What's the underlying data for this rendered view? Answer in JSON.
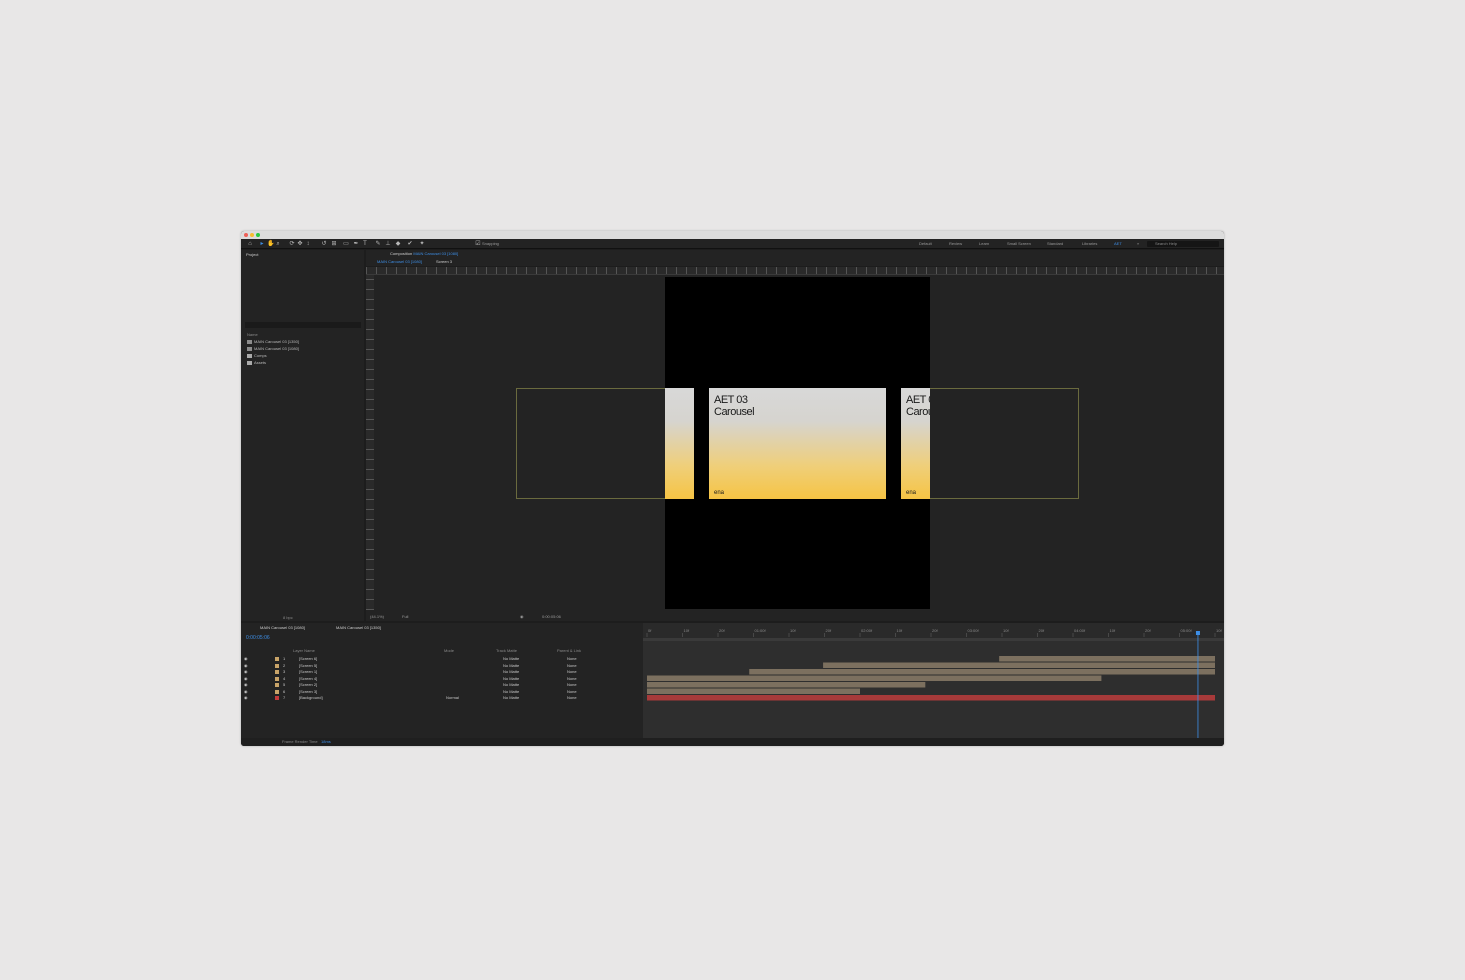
{
  "app": {
    "workspaces": [
      "Default",
      "Review",
      "Learn",
      "Small Screen",
      "Standard",
      "Libraries",
      "AET"
    ],
    "search_placeholder": "Search Help",
    "snapping_label": "Snapping"
  },
  "project": {
    "tab_label": "Project",
    "column_name": "Name",
    "items": [
      {
        "label": "MAIN Carousel 03 [1350]",
        "type": "comp"
      },
      {
        "label": "MAIN Carousel 03 [1080]",
        "type": "comp"
      },
      {
        "label": "Comps",
        "type": "folder"
      },
      {
        "label": "Assets",
        "type": "folder"
      }
    ],
    "bpc": "8 bpc"
  },
  "composition": {
    "tab_prefix": "Composition",
    "tab_comp": "MAIN Carousel 03 [1080]",
    "breadcrumb_1": "MAIN Carousel 03 [1080]",
    "breadcrumb_2": "Screen 3",
    "zoom": "(44.1%)",
    "resolution": "Full",
    "timecode": "0:00:05:06",
    "cards": [
      {
        "title_line1": "AET 03",
        "title_line2": "Carousel",
        "logo": "ena"
      },
      {
        "title_line1": "AET 03",
        "title_line2": "Carousel",
        "logo": "ena"
      }
    ]
  },
  "timeline": {
    "tab_1": "MAIN Carousel 03 [1080]",
    "tab_2": "MAIN Carousel 03 [1350]",
    "current_time": "0:00:05:06",
    "columns": {
      "layer_name": "Layer Name",
      "mode": "Mode",
      "track_matte": "Track Matte",
      "parent": "Parent & Link"
    },
    "layers": [
      {
        "num": "1",
        "name": "[Screen 6]",
        "mode": "",
        "matte": "No Matte",
        "parent": "None",
        "color": "#c9a468"
      },
      {
        "num": "2",
        "name": "[Screen 5]",
        "mode": "",
        "matte": "No Matte",
        "parent": "None",
        "color": "#c9a468"
      },
      {
        "num": "3",
        "name": "[Screen 1]",
        "mode": "",
        "matte": "No Matte",
        "parent": "None",
        "color": "#c9a468"
      },
      {
        "num": "4",
        "name": "[Screen 4]",
        "mode": "",
        "matte": "No Matte",
        "parent": "None",
        "color": "#c9a468"
      },
      {
        "num": "5",
        "name": "[Screen 2]",
        "mode": "",
        "matte": "No Matte",
        "parent": "None",
        "color": "#c9a468"
      },
      {
        "num": "6",
        "name": "[Screen 3]",
        "mode": "",
        "matte": "No Matte",
        "parent": "None",
        "color": "#c9a468"
      },
      {
        "num": "7",
        "name": "[Background]",
        "mode": "Normal",
        "matte": "No Matte",
        "parent": "None",
        "color": "#c43b3b"
      }
    ],
    "ruler_ticks": [
      "0f",
      "10f",
      "20f",
      "01:00f",
      "10f",
      "20f",
      "02:00f",
      "10f",
      "20f",
      "03:00f",
      "10f",
      "20f",
      "04:00f",
      "10f",
      "20f",
      "05:00f",
      "10f"
    ],
    "frame_render_label": "Frame Render Time",
    "frame_render_value": "18ms"
  }
}
